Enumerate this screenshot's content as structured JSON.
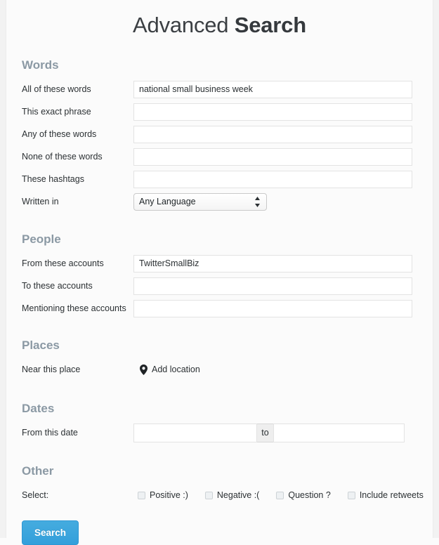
{
  "page": {
    "title_light": "Advanced",
    "title_bold": "Search",
    "accent_color": "#3aa8e0",
    "section_head_color": "#8b99a4",
    "background_color": "#fbfbfb"
  },
  "sections": {
    "words": {
      "heading": "Words",
      "rows": [
        {
          "label": "All of these words",
          "value": "national small business week",
          "placeholder": ""
        },
        {
          "label": "This exact phrase",
          "value": "",
          "placeholder": ""
        },
        {
          "label": "Any of these words",
          "value": "",
          "placeholder": ""
        },
        {
          "label": "None of these words",
          "value": "",
          "placeholder": ""
        },
        {
          "label": "These hashtags",
          "value": "",
          "placeholder": ""
        }
      ],
      "language": {
        "label": "Written in",
        "selected": "Any Language",
        "options": [
          "Any Language"
        ],
        "icon": "chevron-up-down-icon"
      }
    },
    "people": {
      "heading": "People",
      "rows": [
        {
          "label": "From these accounts",
          "value": "TwitterSmallBiz",
          "placeholder": ""
        },
        {
          "label": "To these accounts",
          "value": "",
          "placeholder": ""
        },
        {
          "label": "Mentioning these accounts",
          "value": "",
          "placeholder": ""
        }
      ]
    },
    "places": {
      "heading": "Places",
      "label": "Near this place",
      "add_location_label": "Add location",
      "icon": "map-pin-icon"
    },
    "dates": {
      "heading": "Dates",
      "label": "From this date",
      "from_value": "",
      "from_placeholder": "",
      "separator": "to",
      "to_value": "",
      "to_placeholder": ""
    },
    "other": {
      "heading": "Other",
      "label": "Select:",
      "checkboxes": [
        {
          "label": "Positive :)",
          "checked": false
        },
        {
          "label": "Negative :(",
          "checked": false
        },
        {
          "label": "Question ?",
          "checked": false
        },
        {
          "label": "Include retweets",
          "checked": false
        }
      ]
    }
  },
  "actions": {
    "search_label": "Search"
  }
}
